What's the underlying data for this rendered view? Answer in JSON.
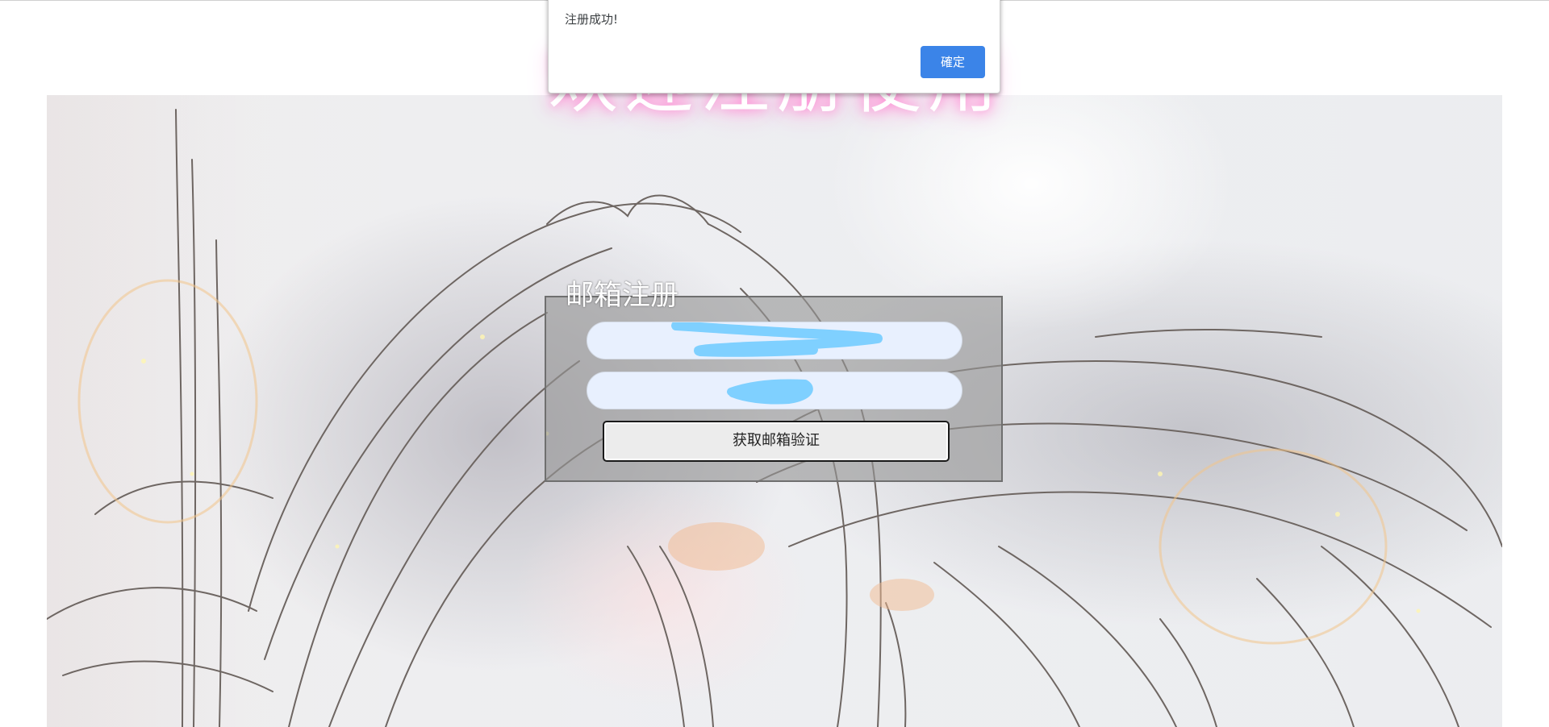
{
  "header": {
    "title": "欢迎注册使用"
  },
  "alert": {
    "origin_text": "",
    "message": "注册成功!",
    "ok_label": "確定"
  },
  "register_form": {
    "legend": "邮箱注册",
    "email_value": "",
    "password_value": "",
    "get_code_label": "获取邮箱验证"
  },
  "colors": {
    "title_glow": "#ff7fd0",
    "alert_button": "#3b84e8",
    "input_background": "#e8f0fe",
    "redaction_scribble": "#7fd0ff"
  }
}
